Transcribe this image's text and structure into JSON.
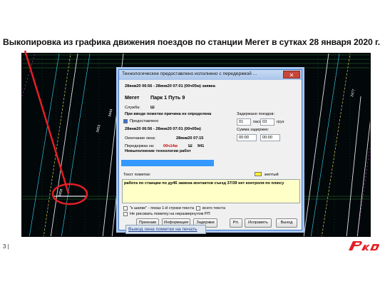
{
  "slide": {
    "title": "Выкопировка из графика движения поездов по станции Мегет в сутках 28 января 2020 г.",
    "page_number": "3 |"
  },
  "dialog": {
    "title": "Технологическое предоставлено исполнено с передержкой ...",
    "close_label": "✕",
    "line1": "28янв20 06:56 - 28янв20 07:01 (00ч05м) заявка",
    "station": "Мегет",
    "park_way": "Парк 1  Путь 9",
    "service_label": "Служба:",
    "service_value": "Ш",
    "reason": "При вводе пометки причина не определена",
    "provided_label": "Предоставлено",
    "line2": "28янв20 06:56 - 28янв20 07:01 (00ч05м)",
    "window_end_label": "Окончание окна:",
    "window_end_value": "28янв20 07:15",
    "overrun_label": "Передержка на:",
    "overrun_value": "00ч14м",
    "overrun_service": "Ш",
    "overrun_code": "941",
    "failure_text": "Невыполнение технологии работ",
    "delay_label": "Задержано поездов:",
    "delay_pass_value": "01",
    "delay_pass_label": "пасс",
    "delay_freight_value": "03",
    "delay_freight_label": "груз",
    "delay_sum_label": "Сумма задержек:",
    "delay_sum_a": "00:00",
    "delay_sum_b": "00:00",
    "note_label": "Текст пометки:",
    "note_color_label": "желтый",
    "note_text": "работа по станции по ду46 замена контактов съезд 37/39 нет контроля по плюсу",
    "option_quotes": "\"к шапке\" - показ 1-й строки текста",
    "option_all_text": "всего текста",
    "option_no_trace": "Не рисовать пометку на неразвернутом РП",
    "buttons": {
      "signs": "Признаки",
      "info": "Информация",
      "delays": "Задержки",
      "prt": "Prt.",
      "fix": "Исправить",
      "exit": "Выход"
    }
  },
  "caption": "Вывод окна пометки на печать",
  "graph_labels": [
    "3458",
    "3453",
    "3444",
    "2477"
  ]
}
